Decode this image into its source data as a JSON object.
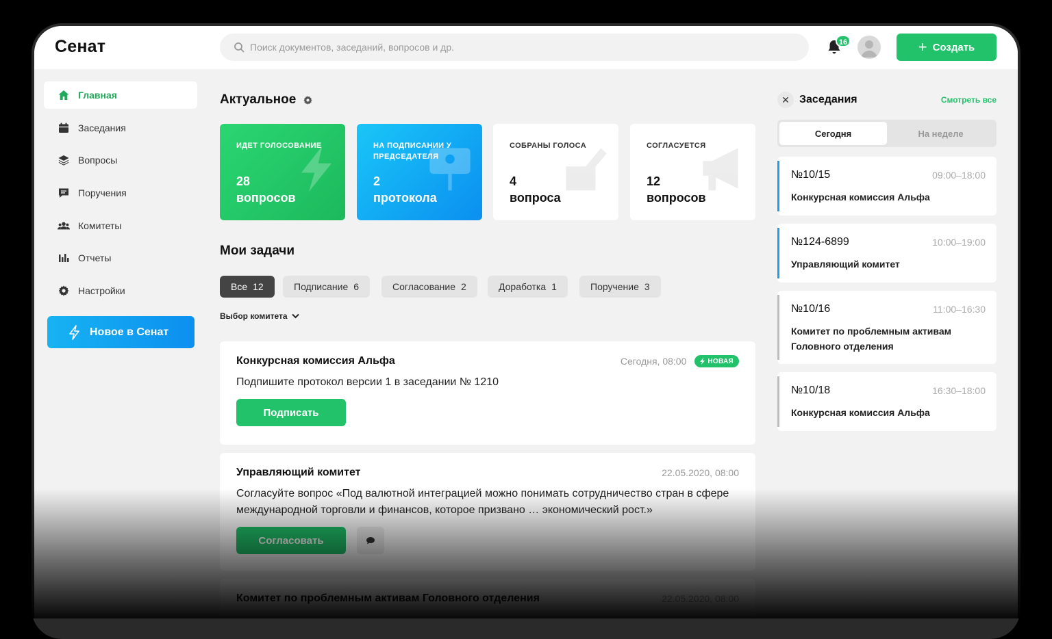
{
  "app": {
    "logo": "Сенат"
  },
  "search": {
    "placeholder": "Поиск документов, заседаний, вопросов и др."
  },
  "header": {
    "notification_count": "16",
    "create_label": "Создать"
  },
  "sidebar": {
    "items": [
      {
        "label": "Главная",
        "icon": "home-icon",
        "active": true
      },
      {
        "label": "Заседания",
        "icon": "calendar-icon"
      },
      {
        "label": "Вопросы",
        "icon": "layers-icon"
      },
      {
        "label": "Поручения",
        "icon": "message-icon"
      },
      {
        "label": "Комитеты",
        "icon": "people-icon"
      },
      {
        "label": "Отчеты",
        "icon": "bar-chart-icon"
      },
      {
        "label": "Настройки",
        "icon": "gear-icon"
      }
    ],
    "new_button": "Новое в Сенат"
  },
  "main": {
    "actual_title": "Актуальное",
    "stats": [
      {
        "label": "Идет голосование",
        "value": "28",
        "unit": "вопросов",
        "color": "#21c26a"
      },
      {
        "label": "На подписании у председателя",
        "value": "2",
        "unit": "протокола",
        "color": "#0b8ff0"
      },
      {
        "label": "Собраны голоса",
        "value": "4",
        "unit": "вопроса",
        "color": "#ffffff"
      },
      {
        "label": "Согласуется",
        "value": "12",
        "unit": "вопросов",
        "color": "#ffffff"
      }
    ],
    "tasks_title": "Мои задачи",
    "filters": [
      {
        "label": "Все",
        "count": "12",
        "active": true
      },
      {
        "label": "Подписание",
        "count": "6"
      },
      {
        "label": "Согласование",
        "count": "2"
      },
      {
        "label": "Доработка",
        "count": "1"
      },
      {
        "label": "Поручение",
        "count": "3"
      }
    ],
    "committee_select": "Выбор комитета",
    "tasks": [
      {
        "title": "Конкурсная комиссия Альфа",
        "date": "Сегодня, 08:00",
        "badge": "НОВАЯ",
        "text": "Подпишите протокол версии 1 в заседании № 1210",
        "action": "Подписать"
      },
      {
        "title": "Управляющий комитет",
        "date": "22.05.2020, 08:00",
        "text": "Согласуйте вопрос «Под валютной интеграцией можно понимать сотрудничество стран в сфере международной торговли и финансов, которое призвано … экономический рост.»",
        "action": "Согласовать"
      },
      {
        "title": "Комитет по проблемным активам Головного отделения",
        "date": "22.05.2020, 08:00"
      }
    ]
  },
  "meetings": {
    "title": "Заседания",
    "see_all": "Смотреть все",
    "tabs": [
      "Сегодня",
      "На неделе"
    ],
    "items": [
      {
        "number": "№10/15",
        "time": "09:00–18:00",
        "name": "Конкурсная комиссия Альфа",
        "accent": "#1a9cf0"
      },
      {
        "number": "№124-6899",
        "time": "10:00–19:00",
        "name": "Управляющий комитет",
        "accent": "#1a9cf0"
      },
      {
        "number": "№10/16",
        "time": "11:00–16:30",
        "name": "Комитет по проблемным активам Головного отделения",
        "accent": "#bdbdbd"
      },
      {
        "number": "№10/18",
        "time": "16:30–18:00",
        "name": "Конкурсная комиссия Альфа",
        "accent": "#bdbdbd"
      }
    ]
  }
}
